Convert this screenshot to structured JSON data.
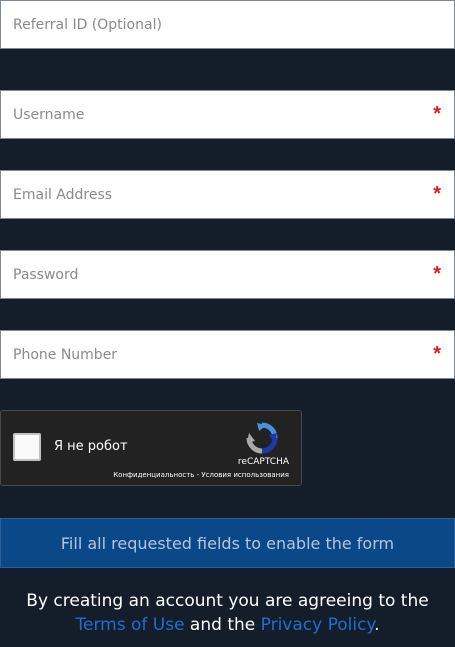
{
  "form": {
    "referral": {
      "placeholder": "Referral ID (Optional)",
      "required": false
    },
    "username": {
      "placeholder": "Username",
      "required": true
    },
    "email": {
      "placeholder": "Email Address",
      "required": true
    },
    "password": {
      "placeholder": "Password",
      "required": true
    },
    "phone": {
      "placeholder": "Phone Number",
      "required": true
    },
    "required_marker": "*"
  },
  "recaptcha": {
    "label": "Я не робот",
    "brand": "reCAPTCHA",
    "privacy_link": "Конфиденциальность",
    "separator": " - ",
    "terms_link": "Условия использования"
  },
  "submit": {
    "label": "Fill all requested fields to enable the form"
  },
  "legal": {
    "prefix": "By creating an account you are agreeing to the ",
    "terms_link": "Terms of Use",
    "middle": " and the ",
    "privacy_link": "Privacy Policy",
    "suffix": "."
  },
  "colors": {
    "background": "#141e2b",
    "required": "#e3191c",
    "button": "#0a4887",
    "link": "#1e6fd1"
  }
}
